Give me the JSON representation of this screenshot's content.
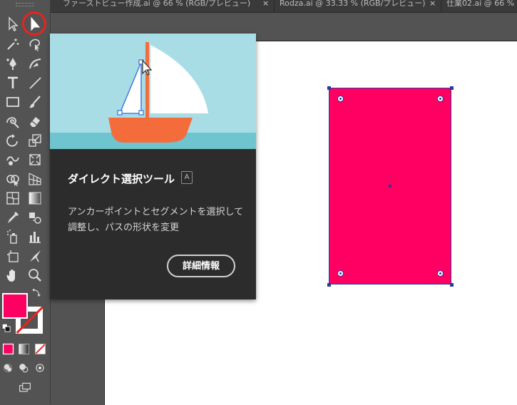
{
  "tabs": [
    {
      "label": "ファーストビュー作成.ai @ 66 % (RGB/プレビュー)"
    },
    {
      "label": "Rodza.ai @ 33.33 % (RGB/プレビュー)"
    },
    {
      "label": "仕業02.ai @ 66 % (RGB/プ"
    }
  ],
  "tab_close_glyph": "×",
  "tooltip": {
    "title": "ダイレクト選択ツール",
    "shortcut": "A",
    "description": "アンカーポイントとセグメントを選択して調整し、パスの形状を変更",
    "button": "詳細情報"
  },
  "colors": {
    "fill": "#ff0062",
    "highlight": "#e8231f",
    "tooltip_bg": "#2c2c2c",
    "tooltip_sky": "#a9dde5",
    "boat_hull": "#f46c3c"
  },
  "tools": [
    "selection-tool-icon",
    "direct-selection-tool-icon",
    "magic-wand-tool-icon",
    "lasso-tool-icon",
    "pen-tool-icon",
    "curvature-tool-icon",
    "type-tool-icon",
    "line-segment-tool-icon",
    "rectangle-tool-icon",
    "paintbrush-tool-icon",
    "shaper-tool-icon",
    "eraser-tool-icon",
    "rotate-tool-icon",
    "scale-tool-icon",
    "warp-tool-icon",
    "free-transform-tool-icon",
    "shape-builder-tool-icon",
    "perspective-grid-tool-icon",
    "mesh-tool-icon",
    "gradient-tool-icon",
    "eyedropper-tool-icon",
    "blend-tool-icon",
    "symbol-sprayer-tool-icon",
    "column-graph-tool-icon",
    "artboard-tool-icon",
    "slice-tool-icon",
    "hand-tool-icon",
    "zoom-tool-icon"
  ]
}
